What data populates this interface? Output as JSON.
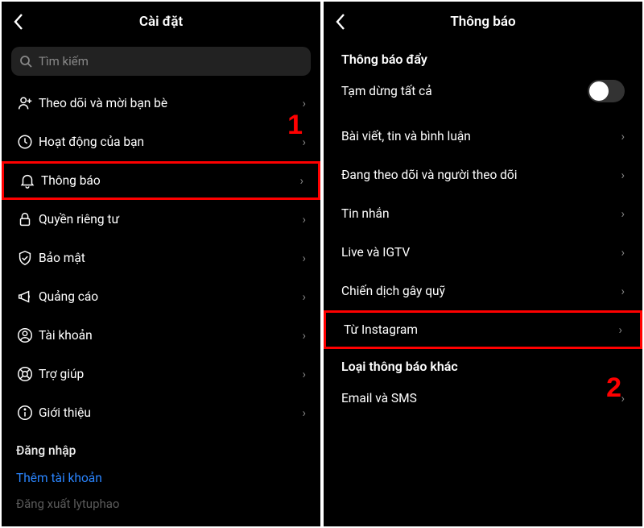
{
  "left": {
    "title": "Cài đặt",
    "search_placeholder": "Tìm kiếm",
    "items": [
      {
        "label": "Theo dõi và mời bạn bè"
      },
      {
        "label": "Hoạt động của bạn"
      },
      {
        "label": "Thông báo"
      },
      {
        "label": "Quyền riêng tư"
      },
      {
        "label": "Bảo mật"
      },
      {
        "label": "Quảng cáo"
      },
      {
        "label": "Tài khoản"
      },
      {
        "label": "Trợ giúp"
      },
      {
        "label": "Giới thiệu"
      }
    ],
    "login_header": "Đăng nhập",
    "add_account": "Thêm tài khoản",
    "logout_partial": "Đăng xuất lytuphao",
    "annotation": "1"
  },
  "right": {
    "title": "Thông báo",
    "section_push": "Thông báo đẩy",
    "pause_all": "Tạm dừng tất cả",
    "items": [
      {
        "label": "Bài viết, tin và bình luận"
      },
      {
        "label": "Đang theo dõi và người theo dõi"
      },
      {
        "label": "Tin nhắn"
      },
      {
        "label": "Live và IGTV"
      },
      {
        "label": "Chiến dịch gây quỹ"
      },
      {
        "label": "Từ Instagram"
      }
    ],
    "section_other": "Loại thông báo khác",
    "other_items": [
      {
        "label": "Email và SMS"
      }
    ],
    "annotation": "2"
  }
}
